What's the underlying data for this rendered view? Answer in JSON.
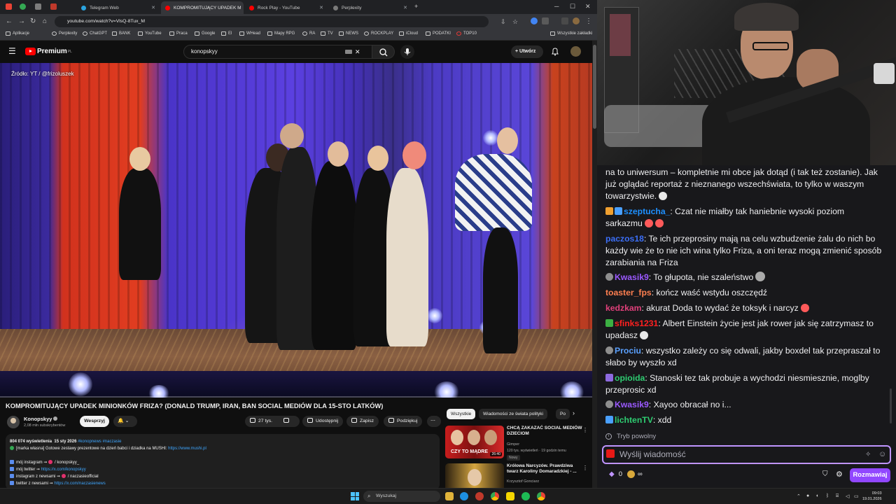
{
  "browser": {
    "tabs": [
      {
        "title": "Telegram Web",
        "active": false
      },
      {
        "title": "KOMPROMITUJĄCY UPADEK M",
        "active": true
      },
      {
        "title": "Rock Play - YouTube",
        "active": false
      },
      {
        "title": "Perplexity",
        "active": false
      }
    ],
    "url": "youtube.com/watch?v=VlsQ-8Tux_M",
    "bookmarks": [
      "Aplikacje",
      "Perplexity",
      "ChatGPT",
      "BANK",
      "YouTube",
      "Praca",
      "Google",
      "El",
      "WHead",
      "Mapy RPG",
      "RA",
      "TV",
      "NEWS",
      "ROCKPLAY",
      "iCloud",
      "PODATKI",
      "TOP10"
    ],
    "bookmarks_all": "Wszystkie zakładki"
  },
  "youtube": {
    "logo_text": "Premium",
    "logo_country": "PL",
    "search_value": "konopskyy",
    "create_label": "Utwórz",
    "video_source": "Źródło: YT / @frizoluszek",
    "video_title": "KOMPROMITUJĄCY UPADEK MINIONKÓW FRIZA? (DONALD TRUMP, IRAN, BAN SOCIAL MEDIÓW DLA 15-STO LATKÓW)",
    "channel_name": "Konopskyy",
    "subscribers": "2,08 mln subskrybentów",
    "support_label": "Wesprzyj",
    "likes": "27 tys.",
    "share_label": "Udostępnij",
    "save_label": "Zapisz",
    "thanks_label": "Podziękuj",
    "description": {
      "views": "804 074 wyświetlenia",
      "date": "15 sty 2026",
      "tags": "#konopnews #naczasie",
      "line1_text": "[marka własna] Gotowe zestawy prezentowe na dzień babci i dziadka na MUSHI: ",
      "line1_link": "https://www.mushi.pl",
      "line2": "mój instagram ➞ ",
      "line2_handle": "/ konopskyy_",
      "line3": "mój twitter ➞ ",
      "line3_link": "https://x.com/konopskyy",
      "line4": "instagram z newsami ➞ ",
      "line4_handle": "/ naczasieofficial",
      "line5": "twitter z newsami ➞ ",
      "line5_link": "https://x.com/naczasienews"
    },
    "chips": [
      "Wszystkie",
      "Wiadomości ze świata polityki",
      "Po"
    ],
    "recommendations": [
      {
        "title": "CHCĄ ZAKAZAĆ SOCIAL MEDIÓW DZIECIOM",
        "channel": "Gimper",
        "stats": "120 tys. wyświetleń · 19 godzin temu",
        "badge": "Nowy",
        "thumb_text": "CZY TO MĄDRE",
        "duration": "26:40"
      },
      {
        "title": "Królowa Narcyzów. Prawdziwa twarz Karoliny Domaradzkiej - ...",
        "channel": "Krzysztof Gonciarz",
        "stats": "",
        "badge": "",
        "thumb_text": "",
        "duration": ""
      }
    ]
  },
  "chat": {
    "first_text": "na to uniwersum – kompletnie mi obce jak dotąd (i tak też zostanie). Jak już oglądać reportaż z nieznanego wszechświata, to tylko w waszym towarzystwie.",
    "messages": [
      {
        "user": "szeptucha_",
        "color": "#1e90ff",
        "text": "Czat nie miałby tak haniebnie wysoki poziom sarkazmu"
      },
      {
        "user": "paczos18",
        "color": "#3b6ef6",
        "text": "Te ich przeprosiny mają na celu wzbudzenie żalu do nich bo każdy wie że to nie ich wina tylko Friza, a oni teraz mogą zmienić sposób zarabiania na Friza"
      },
      {
        "user": "Kwasik9",
        "color": "#9b59ff",
        "text": "To głupota, nie szaleństwo"
      },
      {
        "user": "toaster_fps",
        "color": "#ff7f50",
        "text": "kończ waść wstydu oszczędź"
      },
      {
        "user": "kedzkam",
        "color": "#e0407a",
        "text": "akurat Doda to wydać że toksyk i narcyz"
      },
      {
        "user": "sfinks1231",
        "color": "#ff2020",
        "text": "Albert Einstein życie jest jak rower jak się zatrzymasz to upadasz"
      },
      {
        "user": "Prociu",
        "color": "#5aa0ff",
        "text": "wszystko zależy co się odwali, jakby boxdel tak przepraszał to słabo by wyszło xd"
      },
      {
        "user": "opioida",
        "color": "#2ecc71",
        "text": "Stanoski tez tak probuje a wychodzi niesmiesznie, moglby przeprosic xd"
      },
      {
        "user": "Kwasik9",
        "color": "#9b59ff",
        "text": "Xayoo obracał no i..."
      },
      {
        "user": "lichtenTV",
        "color": "#2ecc71",
        "text": "xdd"
      }
    ],
    "mode": "Tryb powolny",
    "input_placeholder": "Wyślij wiadomość",
    "points": "0",
    "send_label": "Rozmawiaj"
  },
  "taskbar": {
    "search_placeholder": "Wyszukaj",
    "time": "09:03",
    "date": "19.01.2026"
  }
}
